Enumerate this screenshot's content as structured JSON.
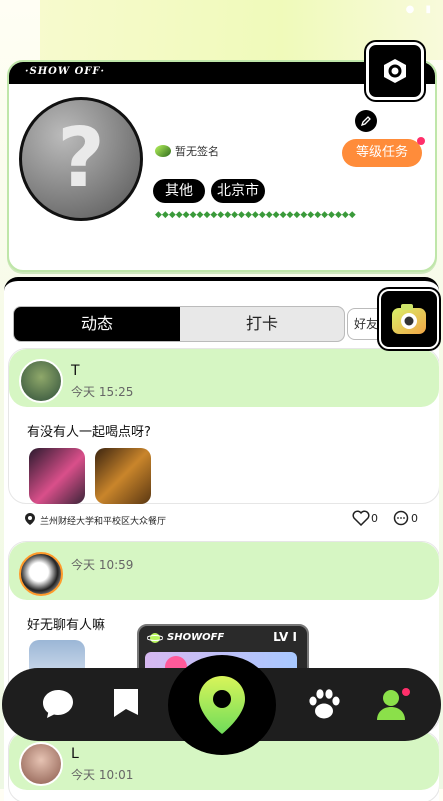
{
  "profile": {
    "brand": "·SHOW OFF·",
    "signature": "暂无签名",
    "tags": [
      "其他",
      "北京市"
    ],
    "diamond_row": "◆◆◆◆◆◆◆◆◆◆◆◆◆◆◆◆◆◆◆◆◆◆◆◆◆◆◆◆◆",
    "level_task_label": "等级任务",
    "avatar_placeholder": "?"
  },
  "tabs": {
    "moments": "动态",
    "checkin": "打卡",
    "friends": "好友"
  },
  "posts": [
    {
      "name": "T",
      "time": "今天 15:25",
      "text": "有没有人一起喝点呀?",
      "location": "兰州财经大学和平校区大众餐厅",
      "likes": "0",
      "comments": "0"
    },
    {
      "name": "",
      "time": "今天 10:59",
      "text": "好无聊有人嘛"
    },
    {
      "name": "L",
      "time": "今天 10:01"
    }
  ],
  "badge": {
    "title": "SHOWOFF",
    "level": "LV I"
  },
  "colors": {
    "accent_green": "#d6f6c3",
    "level_orange": "#ff8c3a",
    "nav_dark": "#1e1e1e",
    "pin_gradient": "#b8f55e"
  },
  "icons": [
    "settings-hex-icon",
    "edit-pencil-icon",
    "camera-icon",
    "location-pin-icon",
    "heart-icon",
    "comment-icon",
    "chat-bubble-icon",
    "flag-icon",
    "paw-icon",
    "user-icon"
  ]
}
